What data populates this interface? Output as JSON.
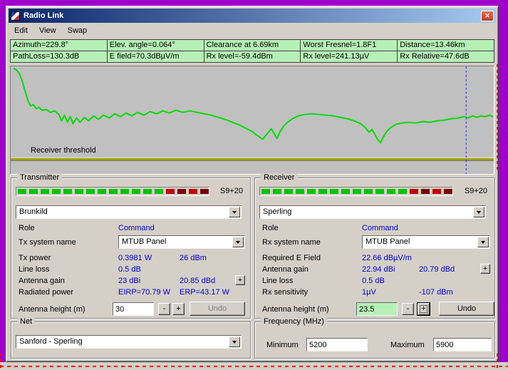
{
  "desktop": {
    "background_color": "#a000cc"
  },
  "window": {
    "title": "Radio Link"
  },
  "icons": {
    "close": "✕"
  },
  "menu": {
    "items": [
      "Edit",
      "View",
      "Swap"
    ]
  },
  "info_panel": {
    "cell_color": "#b6f0b6",
    "row1": [
      "Azimuth=229.8°",
      "Elev. angle=0.064°",
      "Clearance at 6.69km",
      "Worst Fresnel=1.8F1",
      "Distance=13.46km"
    ],
    "row2": [
      "PathLoss=130.3dB",
      "E field=70.3dBµV/m",
      "Rx level=-59.4dBm",
      "Rx level=241.13µV",
      "Rx Relative=47.6dB"
    ]
  },
  "chart": {
    "background_color": "#c0c0c0",
    "line_color": "#00dd00",
    "threshold_color": "#a0a000",
    "cursor_color": "#2222ff",
    "threshold_label": "Receiver threshold",
    "profile": [
      [
        4,
        3
      ],
      [
        8,
        5
      ],
      [
        12,
        10
      ],
      [
        16,
        20
      ],
      [
        20,
        34
      ],
      [
        24,
        47
      ],
      [
        28,
        56
      ],
      [
        32,
        54
      ],
      [
        36,
        60
      ],
      [
        40,
        58
      ],
      [
        44,
        62
      ],
      [
        50,
        61
      ],
      [
        56,
        65
      ],
      [
        62,
        63
      ],
      [
        68,
        68
      ],
      [
        72,
        77
      ],
      [
        76,
        69
      ],
      [
        80,
        79
      ],
      [
        84,
        71
      ],
      [
        88,
        81
      ],
      [
        93,
        73
      ],
      [
        98,
        79
      ],
      [
        104,
        72
      ],
      [
        110,
        77
      ],
      [
        117,
        70
      ],
      [
        124,
        75
      ],
      [
        131,
        69
      ],
      [
        139,
        73
      ],
      [
        147,
        67
      ],
      [
        155,
        71
      ],
      [
        163,
        66
      ],
      [
        171,
        70
      ],
      [
        179,
        65
      ],
      [
        188,
        69
      ],
      [
        197,
        64
      ],
      [
        206,
        67
      ],
      [
        215,
        63
      ],
      [
        224,
        66
      ],
      [
        233,
        62
      ],
      [
        243,
        65
      ],
      [
        253,
        63
      ],
      [
        263,
        65
      ],
      [
        273,
        67
      ],
      [
        283,
        69
      ],
      [
        293,
        72
      ],
      [
        303,
        75
      ],
      [
        313,
        79
      ],
      [
        323,
        83
      ],
      [
        333,
        88
      ],
      [
        342,
        93
      ],
      [
        350,
        99
      ],
      [
        356,
        103
      ],
      [
        360,
        98
      ],
      [
        364,
        93
      ],
      [
        368,
        88
      ],
      [
        372,
        95
      ],
      [
        376,
        102
      ],
      [
        380,
        93
      ],
      [
        385,
        85
      ],
      [
        391,
        79
      ],
      [
        398,
        74
      ],
      [
        406,
        70
      ],
      [
        415,
        68
      ],
      [
        425,
        67
      ],
      [
        435,
        68
      ],
      [
        445,
        69
      ],
      [
        455,
        70
      ],
      [
        465,
        72
      ],
      [
        475,
        74
      ],
      [
        485,
        77
      ],
      [
        494,
        81
      ],
      [
        501,
        87
      ],
      [
        506,
        93
      ],
      [
        510,
        89
      ],
      [
        514,
        96
      ],
      [
        518,
        103
      ],
      [
        522,
        108
      ],
      [
        526,
        100
      ],
      [
        531,
        92
      ],
      [
        537,
        86
      ],
      [
        544,
        82
      ],
      [
        552,
        80
      ],
      [
        562,
        79
      ],
      [
        572,
        80
      ],
      [
        582,
        78
      ],
      [
        592,
        79
      ],
      [
        602,
        77
      ],
      [
        612,
        76
      ],
      [
        622,
        74
      ],
      [
        632,
        73
      ],
      [
        640,
        71
      ],
      [
        646,
        73
      ],
      [
        652,
        70
      ],
      [
        658,
        72
      ],
      [
        664,
        70
      ],
      [
        670,
        71
      ],
      [
        676,
        69
      ],
      [
        681,
        71
      ]
    ]
  },
  "meter": {
    "green_count": 13,
    "green_color": "#00c400",
    "red_colors": [
      "#c40000",
      "#7c0000",
      "#c40000",
      "#7c0000"
    ]
  },
  "transmitter": {
    "group_label": "Transmitter",
    "meter_label": "S9+20",
    "station": "Brunkild",
    "role_label": "Role",
    "role_value": "Command",
    "system_label": "Tx system name",
    "system_value": "MTUB Panel",
    "power_label": "Tx power",
    "power_w": "0.3981 W",
    "power_dbm": "26 dBm",
    "loss_label": "Line loss",
    "loss_value": "0.5 dB",
    "gain_label": "Antenna gain",
    "gain_dbi": "23 dBi",
    "gain_dbd": "20.85 dBd",
    "gain_button": "+",
    "radiated_label": "Radiated power",
    "eirp": "EIRP=70.79 W",
    "erp": "ERP=43.17 W",
    "height_label": "Antenna height (m)",
    "height_value": "30",
    "minus": "-",
    "plus": "+",
    "undo": "Undo"
  },
  "receiver": {
    "group_label": "Receiver",
    "meter_label": "S9+20",
    "station": "Sperling",
    "role_label": "Role",
    "role_value": "Command",
    "system_label": "Rx system name",
    "system_value": "MTUB Panel",
    "efield_label": "Required E Field",
    "efield_value": "22.66 dBµV/m",
    "gain_label": "Antenna gain",
    "gain_dbi": "22.94 dBi",
    "gain_dbd": "20.79 dBd",
    "gain_button": "+",
    "loss_label": "Line loss",
    "loss_value": "0.5 dB",
    "sens_label": "Rx sensitivity",
    "sens_uv": "1µV",
    "sens_dbm": "-107 dBm",
    "height_label": "Antenna height (m)",
    "height_value": "23.5",
    "minus": "-",
    "plus": "+",
    "undo": "Undo"
  },
  "net": {
    "group_label": "Net",
    "selected": "Sanford - Sperling"
  },
  "frequency": {
    "group_label": "Frequency (MHz)",
    "min_label": "Minimum",
    "min_value": "5200",
    "max_label": "Maximum",
    "max_value": "5900"
  }
}
